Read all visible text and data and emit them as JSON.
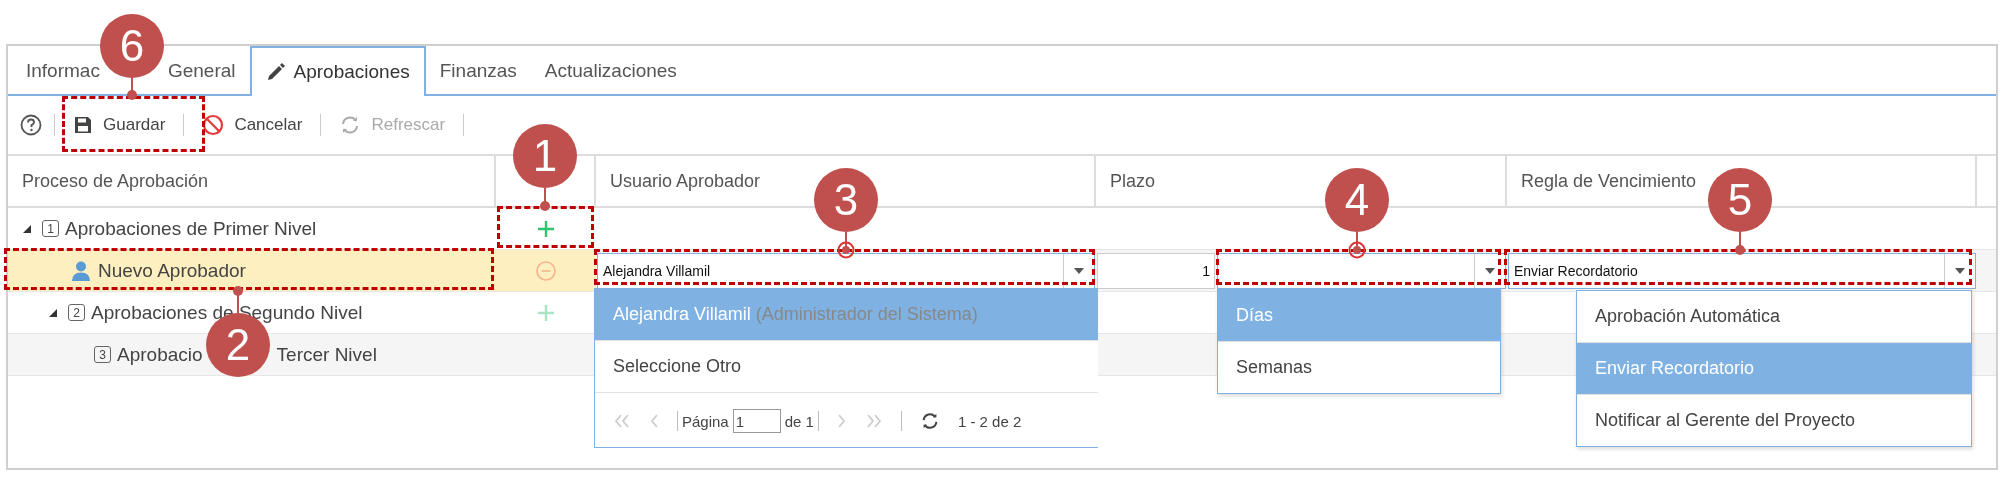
{
  "tabs": [
    {
      "label": "Informac",
      "label_after": "General",
      "selected": false
    },
    {
      "label": "Aprobaciones",
      "selected": true
    },
    {
      "label": "Finanzas",
      "selected": false
    },
    {
      "label": "Actualizaciones",
      "selected": false
    }
  ],
  "toolbar": [
    {
      "kind": "save",
      "label": "Guardar",
      "disabled": false
    },
    {
      "kind": "cancel",
      "label": "Cancelar",
      "disabled": false
    },
    {
      "kind": "refresh",
      "label": "Refrescar",
      "disabled": true
    }
  ],
  "grid": {
    "columns": [
      "Proceso de Aprobación",
      "",
      "Usuario Aprobador",
      "Plazo",
      "Regla de Vencimiento"
    ],
    "rows": [
      {
        "kind": "level",
        "badge": "1",
        "label": "Aprobaciones de Primer Nivel",
        "expanded": true,
        "selected": false,
        "removable": false,
        "dimmed": false,
        "children": [
          {
            "kind": "approver",
            "label": "Nuevo Aprobador",
            "selected": true,
            "removable": true,
            "dimmed": true
          },
          {
            "kind": "level",
            "badge": "2",
            "label": "Aprobaciones de Segundo Nivel",
            "expanded": true,
            "selected": false,
            "removable": false,
            "dimmed": true,
            "children": [
              {
                "kind": "level",
                "badge": "3",
                "label": "Aprobacio",
                "label_after": "Tercer Nivel",
                "selected": false
              }
            ]
          }
        ]
      }
    ],
    "editor": {
      "approver": "Alejandra Villamil",
      "term": "1",
      "rule": "Enviar Recordatorio"
    }
  },
  "approver_dropdown": {
    "items": [
      {
        "name": "Alejandra Villamil",
        "role": "(Administrador del Sistema)",
        "selected": true
      },
      {
        "name": "Seleccione Otro",
        "selected": false
      }
    ],
    "pager": {
      "page_label": "Página",
      "page": "1",
      "of": "de 1",
      "summary": "1 - 2 de 2"
    }
  },
  "unit_dropdown": [
    {
      "label": "Días",
      "selected": true
    },
    {
      "label": "Semanas",
      "selected": false
    }
  ],
  "rule_dropdown": [
    {
      "label": "Aprobación Automática",
      "selected": false
    },
    {
      "label": "Enviar Recordatorio",
      "selected": true
    },
    {
      "label": "Notificar al Gerente del Proyecto",
      "selected": false
    }
  ],
  "callouts": [
    {
      "number": "6",
      "kind": "dot"
    },
    {
      "number": "1",
      "kind": "dot"
    },
    {
      "number": "2",
      "kind": "dot"
    },
    {
      "number": "3",
      "kind": "ring"
    },
    {
      "number": "4",
      "kind": "ring"
    },
    {
      "number": "5",
      "kind": "dot"
    }
  ]
}
